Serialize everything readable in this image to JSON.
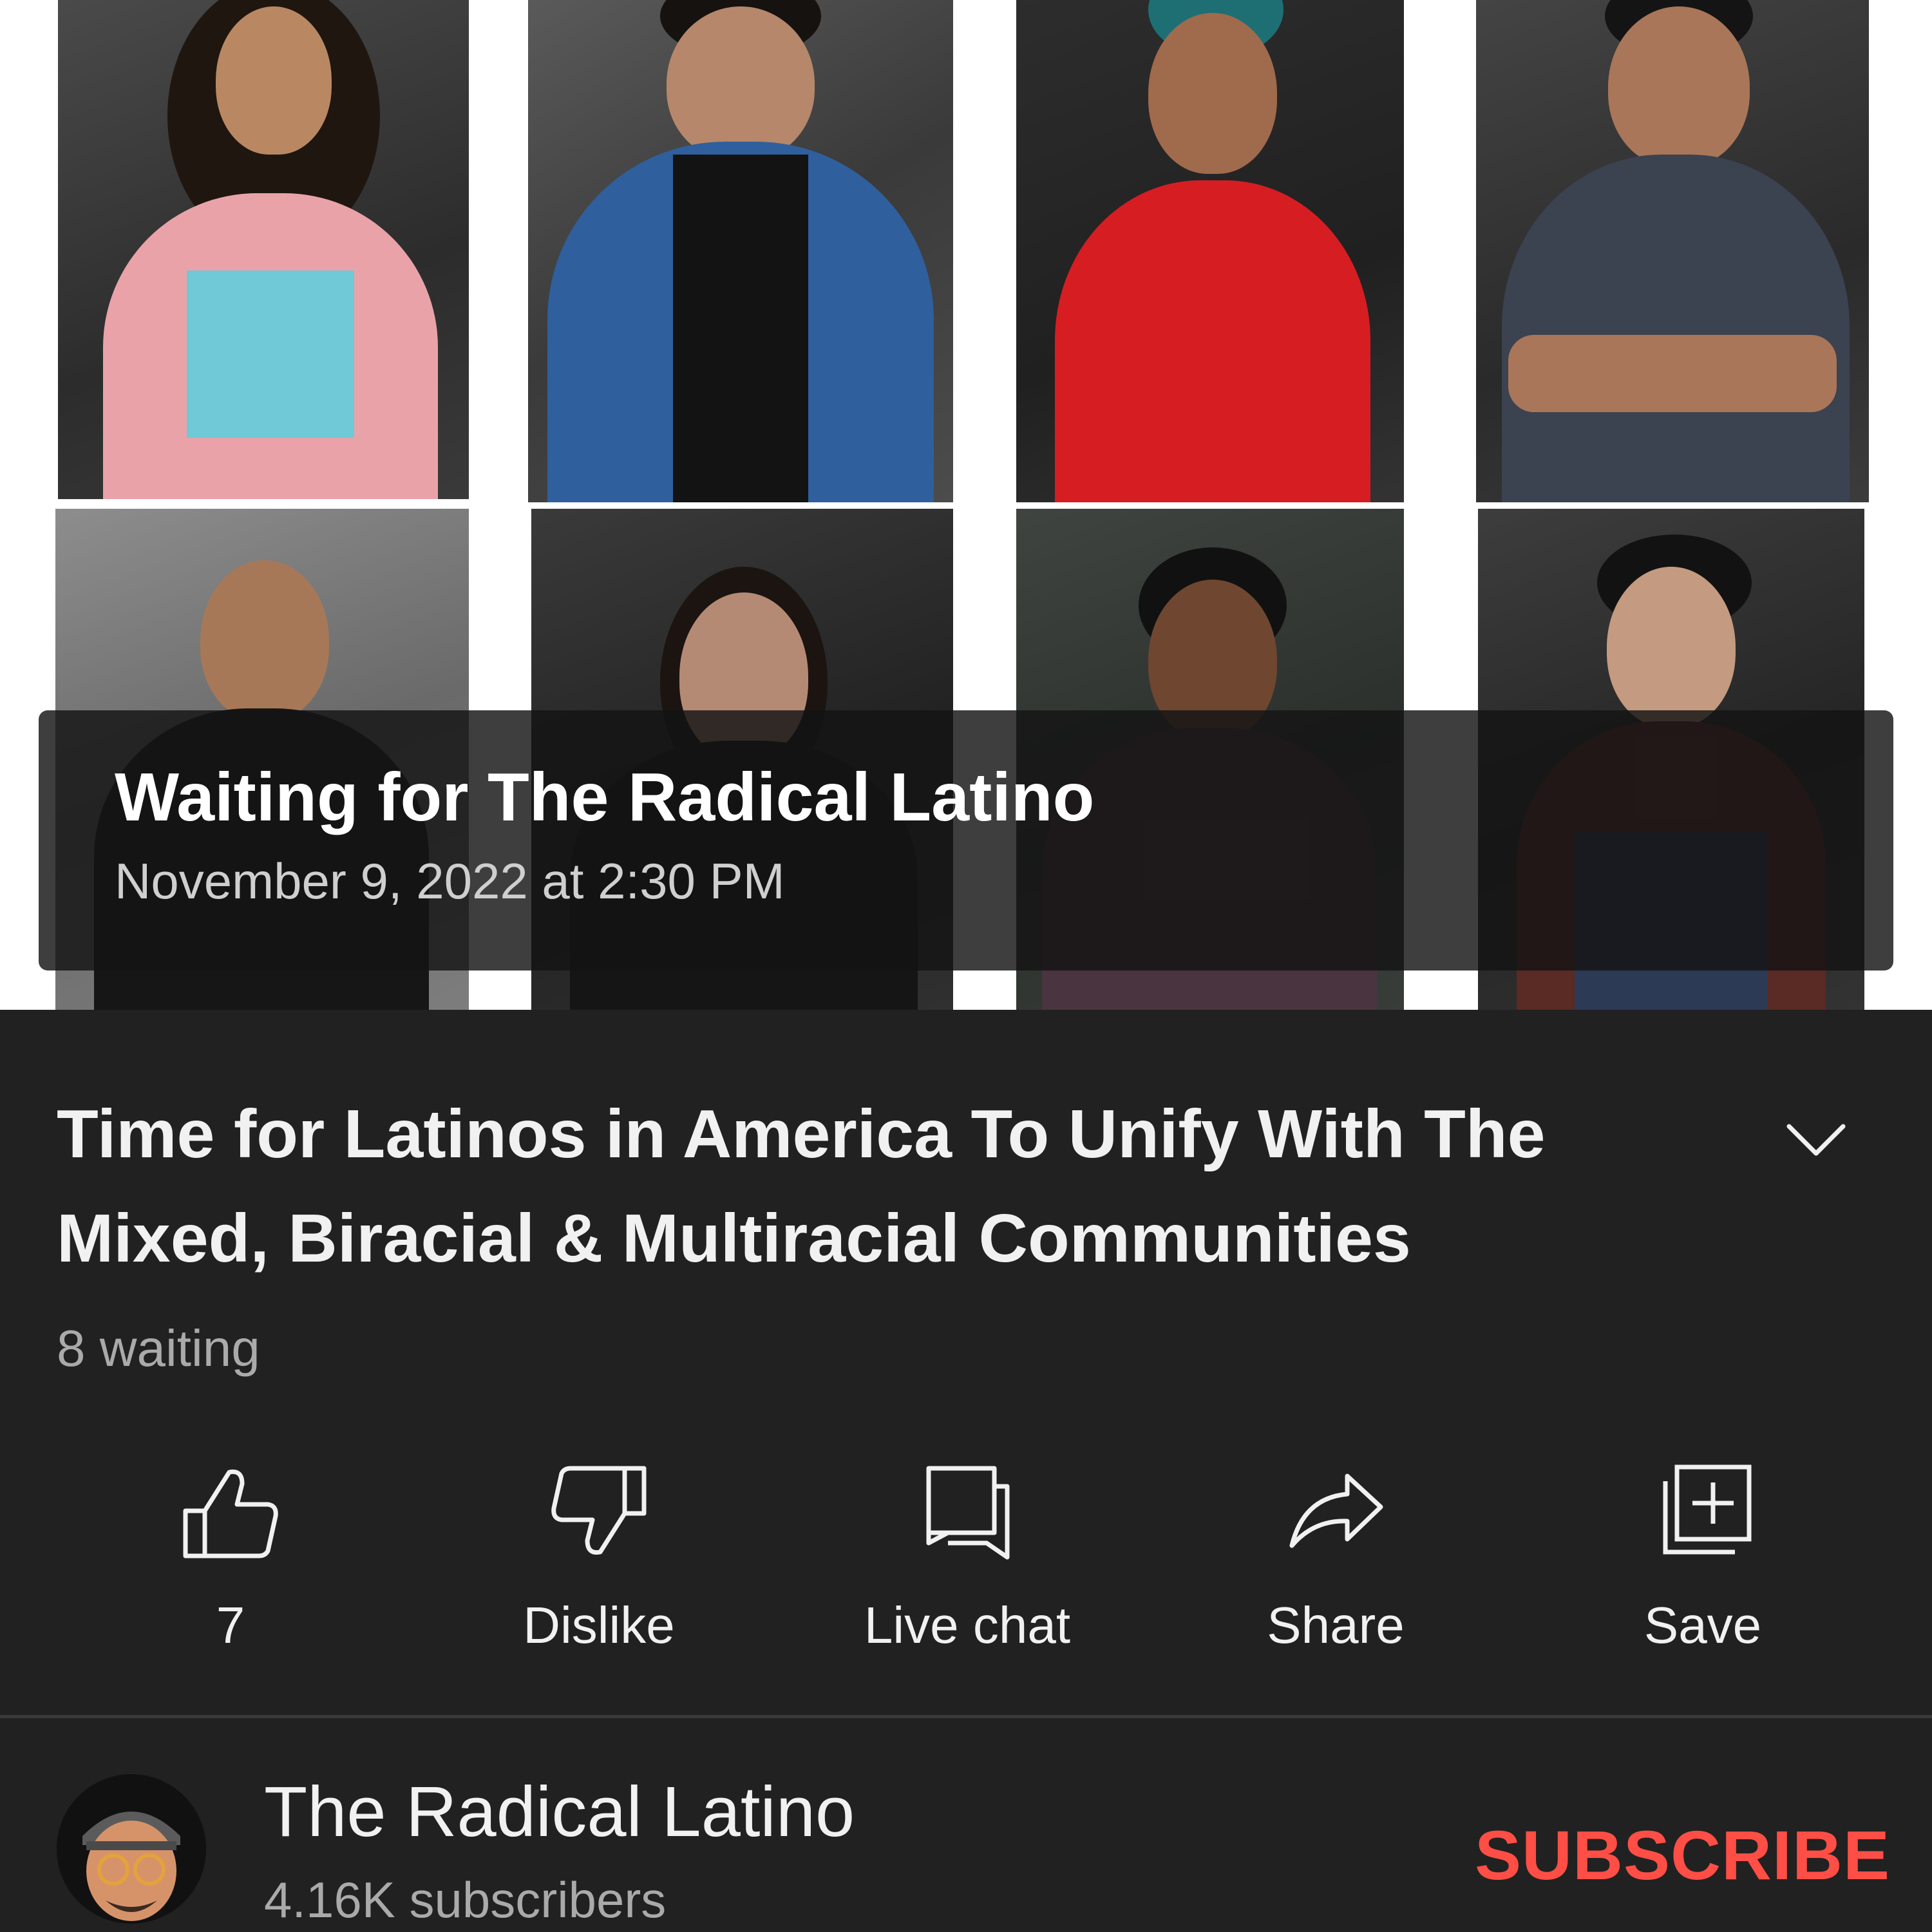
{
  "player": {
    "overlay_title": "Waiting for The Radical Latino",
    "overlay_date": "November 9, 2022 at 2:30 PM"
  },
  "video": {
    "title": "Time for Latinos in America To Unify With The Mixed, Biracial & Multiracial Communities",
    "waiting": "8 waiting"
  },
  "actions": {
    "like_count": "7",
    "dislike_label": "Dislike",
    "live_chat_label": "Live chat",
    "share_label": "Share",
    "save_label": "Save"
  },
  "channel": {
    "name": "The Radical Latino",
    "subscribers": "4.16K subscribers",
    "subscribe_label": "SUBSCRIBE"
  },
  "icons": {
    "like": "thumbs-up-icon",
    "dislike": "thumbs-down-icon",
    "live_chat": "chat-bubble-icon",
    "share": "share-arrow-icon",
    "save": "playlist-add-icon",
    "expand": "chevron-down-icon"
  },
  "colors": {
    "background": "#212121",
    "subscribe": "#ff4e45",
    "secondary_text": "#aaaaaa"
  }
}
